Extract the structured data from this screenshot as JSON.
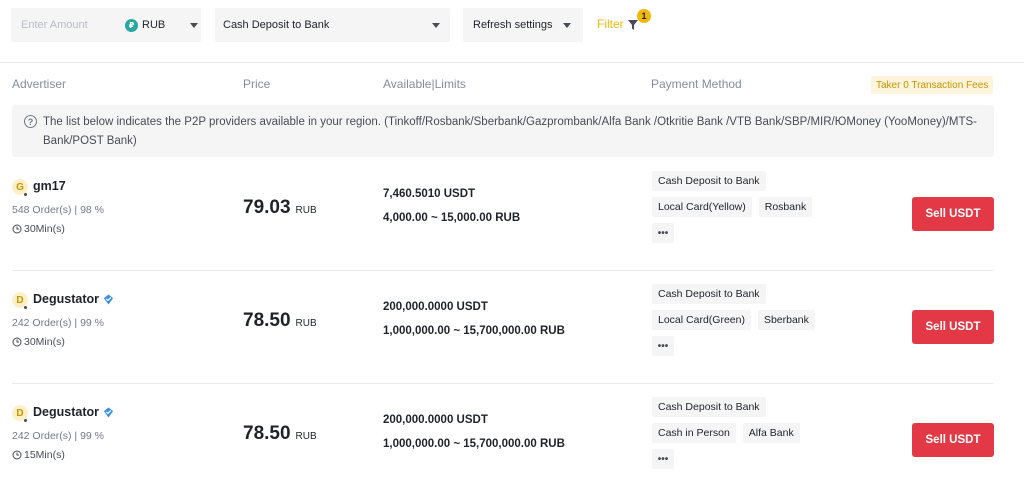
{
  "filters": {
    "amount_placeholder": "Enter Amount",
    "currency": "RUB",
    "currency_icon": "₽",
    "payment_method": "Cash Deposit to Bank",
    "refresh": "Refresh settings",
    "filter_label": "Filter",
    "filter_count": "1"
  },
  "columns": {
    "advertiser": "Advertiser",
    "price": "Price",
    "available": "Available|Limits",
    "payment": "Payment Method",
    "taker_fee": "Taker 0 Transaction Fees"
  },
  "notice": {
    "icon": "?",
    "text": "The list below indicates the P2P providers available in your region. (Tinkoff/Rosbank/Sberbank/Gazprombank/Alfa Bank /Otkritie Bank /VTB Bank/SBP/MIR/ЮMoney (YooMoney)/MTS-Bank/POST Bank)"
  },
  "ads": [
    {
      "initial": "G",
      "name": "gm17",
      "verified": false,
      "orders": "548 Order(s)   |   98 %",
      "time": "30Min(s)",
      "price": "79.03",
      "price_currency": "RUB",
      "available": "7,460.5010 USDT",
      "limits": "4,000.00 ~ 15,000.00 RUB",
      "methods_row1": [
        "Cash Deposit to Bank"
      ],
      "methods_row2": [
        "Local Card(Yellow)",
        "Rosbank"
      ],
      "more": "•••",
      "action": "Sell USDT"
    },
    {
      "initial": "D",
      "name": "Degustator",
      "verified": true,
      "orders": "242 Order(s)   |   99 %",
      "time": "30Min(s)",
      "price": "78.50",
      "price_currency": "RUB",
      "available": "200,000.0000 USDT",
      "limits": "1,000,000.00 ~ 15,700,000.00 RUB",
      "methods_row1": [
        "Cash Deposit to Bank"
      ],
      "methods_row2": [
        "Local Card(Green)",
        "Sberbank"
      ],
      "more": "•••",
      "action": "Sell USDT"
    },
    {
      "initial": "D",
      "name": "Degustator",
      "verified": true,
      "orders": "242 Order(s)   |   99 %",
      "time": "15Min(s)",
      "price": "78.50",
      "price_currency": "RUB",
      "available": "200,000.0000 USDT",
      "limits": "1,000,000.00 ~ 15,700,000.00 RUB",
      "methods_row1": [
        "Cash Deposit to Bank"
      ],
      "methods_row2": [
        "Cash in Person",
        "Alfa Bank"
      ],
      "more": "•••",
      "action": "Sell USDT"
    }
  ],
  "colors": {
    "accent": "#f0b90b",
    "sell": "#e33946",
    "verified": "#3a8ee6"
  }
}
